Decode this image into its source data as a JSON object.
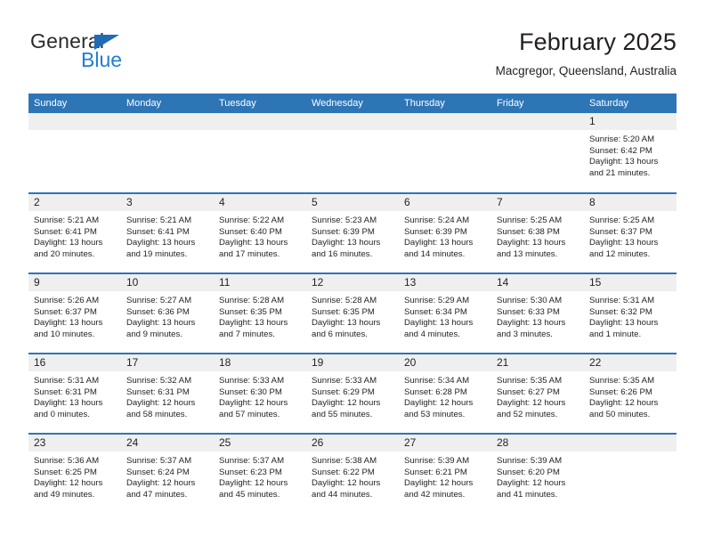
{
  "brand": {
    "name_top": "General",
    "name_bottom": "Blue",
    "triangle_color": "#1e6cb5",
    "blue_color": "#1e7fd4"
  },
  "header": {
    "title": "February 2025",
    "subtitle": "Macgregor, Queensland, Australia"
  },
  "theme": {
    "header_blue": "#2e75b6",
    "daynum_gray": "#efefef",
    "text": "#231f20"
  },
  "weekdays": [
    "Sunday",
    "Monday",
    "Tuesday",
    "Wednesday",
    "Thursday",
    "Friday",
    "Saturday"
  ],
  "weeks": [
    [
      {
        "day": "",
        "sunrise": "",
        "sunset": "",
        "daylight1": "",
        "daylight2": ""
      },
      {
        "day": "",
        "sunrise": "",
        "sunset": "",
        "daylight1": "",
        "daylight2": ""
      },
      {
        "day": "",
        "sunrise": "",
        "sunset": "",
        "daylight1": "",
        "daylight2": ""
      },
      {
        "day": "",
        "sunrise": "",
        "sunset": "",
        "daylight1": "",
        "daylight2": ""
      },
      {
        "day": "",
        "sunrise": "",
        "sunset": "",
        "daylight1": "",
        "daylight2": ""
      },
      {
        "day": "",
        "sunrise": "",
        "sunset": "",
        "daylight1": "",
        "daylight2": ""
      },
      {
        "day": "1",
        "sunrise": "Sunrise: 5:20 AM",
        "sunset": "Sunset: 6:42 PM",
        "daylight1": "Daylight: 13 hours",
        "daylight2": "and 21 minutes."
      }
    ],
    [
      {
        "day": "2",
        "sunrise": "Sunrise: 5:21 AM",
        "sunset": "Sunset: 6:41 PM",
        "daylight1": "Daylight: 13 hours",
        "daylight2": "and 20 minutes."
      },
      {
        "day": "3",
        "sunrise": "Sunrise: 5:21 AM",
        "sunset": "Sunset: 6:41 PM",
        "daylight1": "Daylight: 13 hours",
        "daylight2": "and 19 minutes."
      },
      {
        "day": "4",
        "sunrise": "Sunrise: 5:22 AM",
        "sunset": "Sunset: 6:40 PM",
        "daylight1": "Daylight: 13 hours",
        "daylight2": "and 17 minutes."
      },
      {
        "day": "5",
        "sunrise": "Sunrise: 5:23 AM",
        "sunset": "Sunset: 6:39 PM",
        "daylight1": "Daylight: 13 hours",
        "daylight2": "and 16 minutes."
      },
      {
        "day": "6",
        "sunrise": "Sunrise: 5:24 AM",
        "sunset": "Sunset: 6:39 PM",
        "daylight1": "Daylight: 13 hours",
        "daylight2": "and 14 minutes."
      },
      {
        "day": "7",
        "sunrise": "Sunrise: 5:25 AM",
        "sunset": "Sunset: 6:38 PM",
        "daylight1": "Daylight: 13 hours",
        "daylight2": "and 13 minutes."
      },
      {
        "day": "8",
        "sunrise": "Sunrise: 5:25 AM",
        "sunset": "Sunset: 6:37 PM",
        "daylight1": "Daylight: 13 hours",
        "daylight2": "and 12 minutes."
      }
    ],
    [
      {
        "day": "9",
        "sunrise": "Sunrise: 5:26 AM",
        "sunset": "Sunset: 6:37 PM",
        "daylight1": "Daylight: 13 hours",
        "daylight2": "and 10 minutes."
      },
      {
        "day": "10",
        "sunrise": "Sunrise: 5:27 AM",
        "sunset": "Sunset: 6:36 PM",
        "daylight1": "Daylight: 13 hours",
        "daylight2": "and 9 minutes."
      },
      {
        "day": "11",
        "sunrise": "Sunrise: 5:28 AM",
        "sunset": "Sunset: 6:35 PM",
        "daylight1": "Daylight: 13 hours",
        "daylight2": "and 7 minutes."
      },
      {
        "day": "12",
        "sunrise": "Sunrise: 5:28 AM",
        "sunset": "Sunset: 6:35 PM",
        "daylight1": "Daylight: 13 hours",
        "daylight2": "and 6 minutes."
      },
      {
        "day": "13",
        "sunrise": "Sunrise: 5:29 AM",
        "sunset": "Sunset: 6:34 PM",
        "daylight1": "Daylight: 13 hours",
        "daylight2": "and 4 minutes."
      },
      {
        "day": "14",
        "sunrise": "Sunrise: 5:30 AM",
        "sunset": "Sunset: 6:33 PM",
        "daylight1": "Daylight: 13 hours",
        "daylight2": "and 3 minutes."
      },
      {
        "day": "15",
        "sunrise": "Sunrise: 5:31 AM",
        "sunset": "Sunset: 6:32 PM",
        "daylight1": "Daylight: 13 hours",
        "daylight2": "and 1 minute."
      }
    ],
    [
      {
        "day": "16",
        "sunrise": "Sunrise: 5:31 AM",
        "sunset": "Sunset: 6:31 PM",
        "daylight1": "Daylight: 13 hours",
        "daylight2": "and 0 minutes."
      },
      {
        "day": "17",
        "sunrise": "Sunrise: 5:32 AM",
        "sunset": "Sunset: 6:31 PM",
        "daylight1": "Daylight: 12 hours",
        "daylight2": "and 58 minutes."
      },
      {
        "day": "18",
        "sunrise": "Sunrise: 5:33 AM",
        "sunset": "Sunset: 6:30 PM",
        "daylight1": "Daylight: 12 hours",
        "daylight2": "and 57 minutes."
      },
      {
        "day": "19",
        "sunrise": "Sunrise: 5:33 AM",
        "sunset": "Sunset: 6:29 PM",
        "daylight1": "Daylight: 12 hours",
        "daylight2": "and 55 minutes."
      },
      {
        "day": "20",
        "sunrise": "Sunrise: 5:34 AM",
        "sunset": "Sunset: 6:28 PM",
        "daylight1": "Daylight: 12 hours",
        "daylight2": "and 53 minutes."
      },
      {
        "day": "21",
        "sunrise": "Sunrise: 5:35 AM",
        "sunset": "Sunset: 6:27 PM",
        "daylight1": "Daylight: 12 hours",
        "daylight2": "and 52 minutes."
      },
      {
        "day": "22",
        "sunrise": "Sunrise: 5:35 AM",
        "sunset": "Sunset: 6:26 PM",
        "daylight1": "Daylight: 12 hours",
        "daylight2": "and 50 minutes."
      }
    ],
    [
      {
        "day": "23",
        "sunrise": "Sunrise: 5:36 AM",
        "sunset": "Sunset: 6:25 PM",
        "daylight1": "Daylight: 12 hours",
        "daylight2": "and 49 minutes."
      },
      {
        "day": "24",
        "sunrise": "Sunrise: 5:37 AM",
        "sunset": "Sunset: 6:24 PM",
        "daylight1": "Daylight: 12 hours",
        "daylight2": "and 47 minutes."
      },
      {
        "day": "25",
        "sunrise": "Sunrise: 5:37 AM",
        "sunset": "Sunset: 6:23 PM",
        "daylight1": "Daylight: 12 hours",
        "daylight2": "and 45 minutes."
      },
      {
        "day": "26",
        "sunrise": "Sunrise: 5:38 AM",
        "sunset": "Sunset: 6:22 PM",
        "daylight1": "Daylight: 12 hours",
        "daylight2": "and 44 minutes."
      },
      {
        "day": "27",
        "sunrise": "Sunrise: 5:39 AM",
        "sunset": "Sunset: 6:21 PM",
        "daylight1": "Daylight: 12 hours",
        "daylight2": "and 42 minutes."
      },
      {
        "day": "28",
        "sunrise": "Sunrise: 5:39 AM",
        "sunset": "Sunset: 6:20 PM",
        "daylight1": "Daylight: 12 hours",
        "daylight2": "and 41 minutes."
      },
      {
        "day": "",
        "sunrise": "",
        "sunset": "",
        "daylight1": "",
        "daylight2": ""
      }
    ]
  ]
}
